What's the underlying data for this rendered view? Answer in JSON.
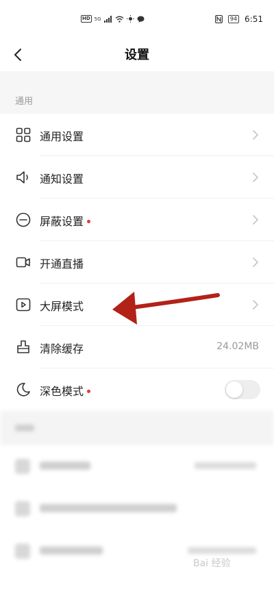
{
  "status_bar": {
    "network_badge": "HD",
    "signal_label": "5G",
    "battery": "94",
    "time": "6:51"
  },
  "header": {
    "title": "设置"
  },
  "section": {
    "title": "通用"
  },
  "items": [
    {
      "label": "通用设置",
      "icon": "grid-icon",
      "badge": false,
      "trailing": "chevron"
    },
    {
      "label": "通知设置",
      "icon": "speaker-icon",
      "badge": false,
      "trailing": "chevron"
    },
    {
      "label": "屏蔽设置",
      "icon": "block-icon",
      "badge": true,
      "trailing": "chevron"
    },
    {
      "label": "开通直播",
      "icon": "video-camera-icon",
      "badge": false,
      "trailing": "chevron"
    },
    {
      "label": "大屏模式",
      "icon": "play-screen-icon",
      "badge": false,
      "trailing": "chevron"
    },
    {
      "label": "清除缓存",
      "icon": "broom-icon",
      "badge": false,
      "trailing": "value",
      "value": "24.02MB"
    },
    {
      "label": "深色模式",
      "icon": "moon-icon",
      "badge": true,
      "trailing": "toggle",
      "enabled": false
    }
  ],
  "annotation": {
    "arrow_color": "#b22218"
  },
  "watermark": "Bai 经验",
  "colors": {
    "badge": "#e53935",
    "section_bg": "#f6f6f6",
    "muted_text": "#999999"
  }
}
